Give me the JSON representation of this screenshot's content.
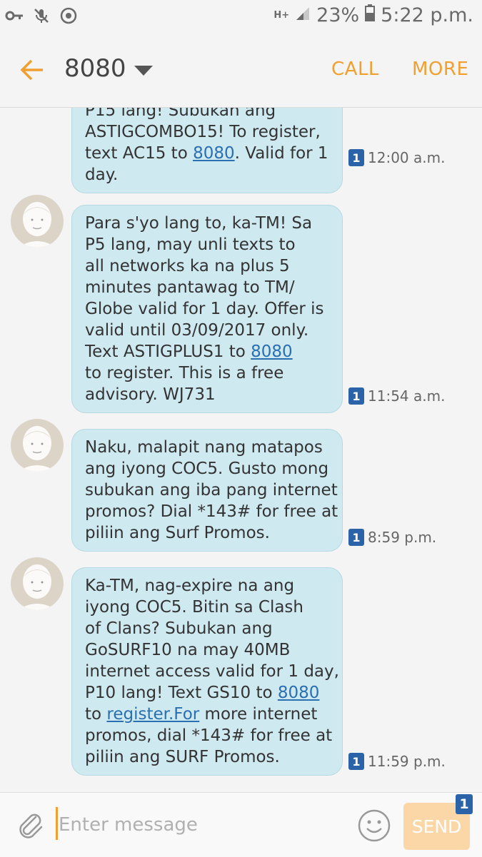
{
  "status_bar": {
    "network": "H+",
    "battery": "23%",
    "time": "5:22 p.m."
  },
  "header": {
    "title": "8080",
    "call_label": "CALL",
    "more_label": "MORE"
  },
  "messages": [
    {
      "lines": [
        [
          {
            "t": "P15 lang! Subukan ang"
          }
        ],
        [
          {
            "t": "ASTIGCOMBO15! To register,"
          }
        ],
        [
          {
            "t": "text AC15 to "
          },
          {
            "t": "8080",
            "link": true
          },
          {
            "t": ". Valid for 1"
          }
        ],
        [
          {
            "t": "day."
          }
        ]
      ],
      "sim": "1",
      "time": "12:00 a.m.",
      "avatar": false
    },
    {
      "lines": [
        [
          {
            "t": "Para s'yo lang to, ka-TM! Sa"
          }
        ],
        [
          {
            "t": "P5 lang, may unli texts to"
          }
        ],
        [
          {
            "t": "all networks ka na plus 5"
          }
        ],
        [
          {
            "t": "minutes pantawag to TM/"
          }
        ],
        [
          {
            "t": "Globe valid for 1 day. Offer is"
          }
        ],
        [
          {
            "t": "valid until 03/09/2017 only."
          }
        ],
        [
          {
            "t": "Text ASTIGPLUS1 to "
          },
          {
            "t": "8080",
            "link": true
          }
        ],
        [
          {
            "t": "to register. This is a free"
          }
        ],
        [
          {
            "t": "advisory. WJ731"
          }
        ]
      ],
      "sim": "1",
      "time": "11:54 a.m.",
      "avatar": true
    },
    {
      "lines": [
        [
          {
            "t": "Naku, malapit nang matapos"
          }
        ],
        [
          {
            "t": "ang iyong COC5. Gusto mong"
          }
        ],
        [
          {
            "t": "subukan ang iba pang internet"
          }
        ],
        [
          {
            "t": "promos? Dial *143# for free at"
          }
        ],
        [
          {
            "t": "piliin ang Surf Promos."
          }
        ]
      ],
      "sim": "1",
      "time": "8:59 p.m.",
      "avatar": true
    },
    {
      "lines": [
        [
          {
            "t": "Ka-TM, nag-expire na ang"
          }
        ],
        [
          {
            "t": "iyong COC5. Bitin sa Clash"
          }
        ],
        [
          {
            "t": "of Clans? Subukan ang"
          }
        ],
        [
          {
            "t": "GoSURF10 na may 40MB"
          }
        ],
        [
          {
            "t": "internet access valid for 1 day,"
          }
        ],
        [
          {
            "t": "P10 lang! Text GS10 to "
          },
          {
            "t": "8080",
            "link": true
          }
        ],
        [
          {
            "t": "to "
          },
          {
            "t": "register.For",
            "link": true
          },
          {
            "t": " more internet"
          }
        ],
        [
          {
            "t": "promos, dial *143# for free at"
          }
        ],
        [
          {
            "t": "piliin ang SURF Promos."
          }
        ]
      ],
      "sim": "1",
      "time": "11:59 p.m.",
      "avatar": true
    }
  ],
  "composer": {
    "placeholder": "Enter message",
    "send_label": "SEND",
    "sim": "1"
  },
  "colors": {
    "accent": "#f0a030",
    "bubble": "#cfe9f0",
    "link": "#2a6fb0",
    "sim_badge": "#2a63a8"
  }
}
